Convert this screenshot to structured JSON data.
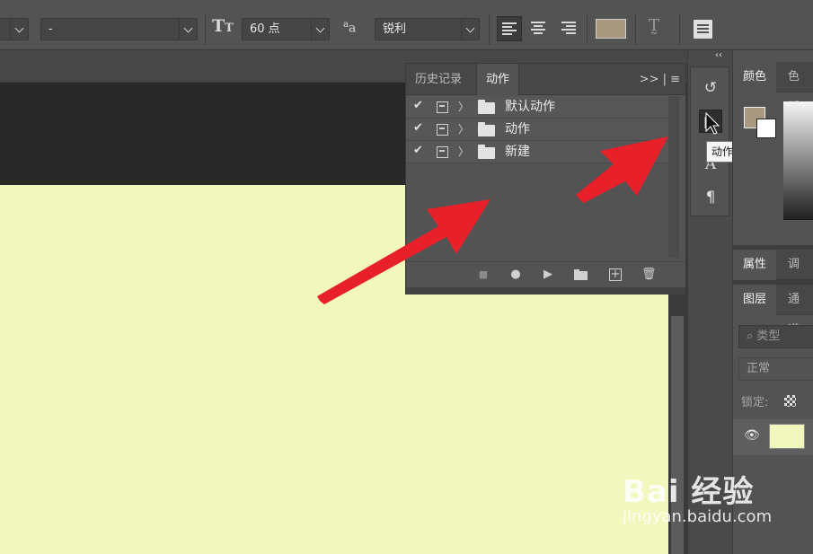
{
  "options_bar": {
    "font_family_value": "",
    "font_style_value": "-",
    "font_size_value": "60 点",
    "antialias_value": "锐利",
    "text_color": "#a89880",
    "icons": [
      "text-orientation-icon",
      "font-size-icon",
      "antialias-icon",
      "align-left-icon",
      "align-center-icon",
      "align-right-icon",
      "warp-text-icon",
      "character-panel-icon"
    ]
  },
  "canvas": {
    "background_color": "#f1f7bd"
  },
  "actions_panel": {
    "tabs": [
      "历史记录",
      "动作"
    ],
    "active_tab": "动作",
    "menu_glyph": ">> | ≡",
    "sets": [
      {
        "label": "默认动作",
        "checked": "✔",
        "expand": "〉"
      },
      {
        "label": "动作",
        "checked": "✔",
        "expand": "〉"
      },
      {
        "label": "新建",
        "checked": "✔",
        "expand": "〉"
      }
    ],
    "footer": {
      "stop": "■",
      "record": "●",
      "play": "▶",
      "new_set": "",
      "new_action": "+",
      "delete": "🗑"
    }
  },
  "icon_strip": {
    "collapse_glyph": "‹‹",
    "history_icon": "↺",
    "actions_icon": "▶",
    "character_icon": "A",
    "paragraph_icon": "¶",
    "tooltip": "动作"
  },
  "right_panels": {
    "color_tabs": [
      "颜色",
      "色板"
    ],
    "properties_tabs": [
      "属性",
      "调整"
    ],
    "layers_tabs": [
      "图层",
      "通道"
    ],
    "search_placeholder": "类型",
    "blend_mode": "正常",
    "lock_label": "锁定:",
    "foreground_color": "#a89880",
    "background_color": "#ffffff",
    "eye_icon": "👁"
  },
  "watermark": {
    "brand": "Bai 经验",
    "url": "jingyan.baidu.com"
  },
  "annotation_color": "#e8202a"
}
